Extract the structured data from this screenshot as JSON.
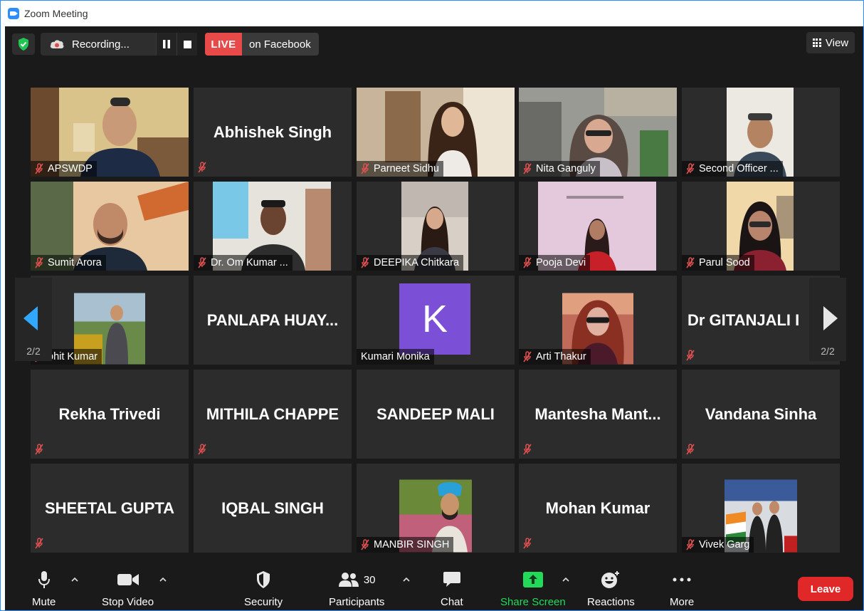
{
  "window": {
    "title": "Zoom Meeting"
  },
  "topbar": {
    "recording_label": "Recording...",
    "live_badge": "LIVE",
    "live_text": "on Facebook",
    "view_label": "View"
  },
  "tiles": {
    "t00": {
      "name": "APSWDP"
    },
    "t01": {
      "name": "Abhishek Singh"
    },
    "t02": {
      "name": "Parneet Sidhu"
    },
    "t03": {
      "name": "Nita Ganguly"
    },
    "t04": {
      "name": "Second Officer ..."
    },
    "t10": {
      "name": "Sumit Arora"
    },
    "t11": {
      "name": "Dr. Om Kumar ..."
    },
    "t12": {
      "name": "DEEPIKA Chitkara"
    },
    "t13": {
      "name": "Pooja Devi"
    },
    "t14": {
      "name": "Parul Sood"
    },
    "t20": {
      "name": "ohit Kumar"
    },
    "t21": {
      "name": "PANLAPA  HUAY..."
    },
    "t22": {
      "name": "Kumari Monika",
      "initial": "K"
    },
    "t23": {
      "name": "Arti Thakur"
    },
    "t24": {
      "name": "Dr  GITANJALI  I"
    },
    "t30": {
      "name": "Rekha Trivedi"
    },
    "t31": {
      "name": "MITHILA CHAPPE"
    },
    "t32": {
      "name": "SANDEEP MALI"
    },
    "t33": {
      "name": "Mantesha  Mant..."
    },
    "t34": {
      "name": "Vandana Sinha"
    },
    "t40": {
      "name": "SHEETAL GUPTA"
    },
    "t41": {
      "name": "IQBAL SINGH"
    },
    "t42": {
      "name": "MANBIR SINGH"
    },
    "t43": {
      "name": "Mohan Kumar"
    },
    "t44": {
      "name": "Vivek Garg"
    }
  },
  "pager": {
    "left": "2/2",
    "right": "2/2"
  },
  "toolbar": {
    "mute": "Mute",
    "stop_video": "Stop Video",
    "security": "Security",
    "participants": "Participants",
    "participants_count": "30",
    "chat": "Chat",
    "share_screen": "Share Screen",
    "reactions": "Reactions",
    "more": "More",
    "leave": "Leave"
  },
  "colors": {
    "accent": "#2d8cff",
    "live": "#e84a4a",
    "share": "#23d959",
    "leave": "#e02828",
    "muted": "#e05050"
  }
}
